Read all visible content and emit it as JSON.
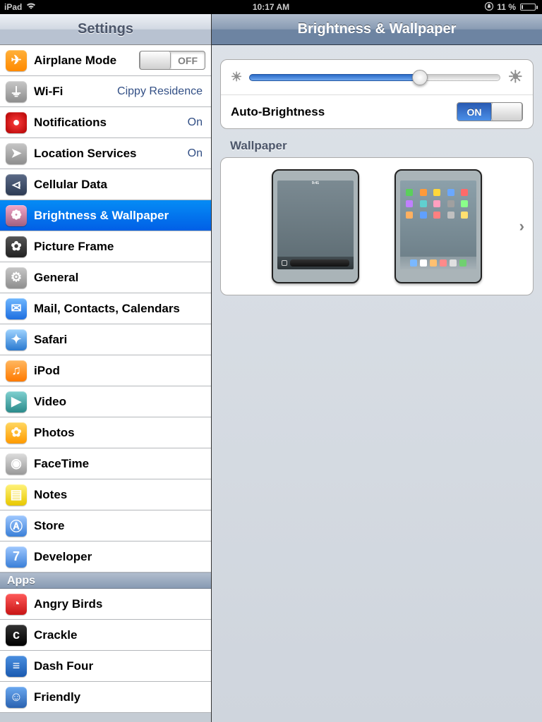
{
  "status": {
    "device": "iPad",
    "time": "10:17 AM",
    "battery_pct": "11 %",
    "battery_fill": 11
  },
  "sidebar": {
    "title": "Settings",
    "items": [
      {
        "label": "Airplane Mode",
        "icon_bg": "linear-gradient(#ffb03a,#ff8a00)",
        "glyph": "✈",
        "toggle": "OFF"
      },
      {
        "label": "Wi-Fi",
        "icon_bg": "linear-gradient(#c7c7c7,#8e8e8e)",
        "glyph": "⏚",
        "value": "Cippy Residence"
      },
      {
        "label": "Notifications",
        "icon_bg": "radial-gradient(#ff4040,#b00000)",
        "glyph": "●",
        "value": "On"
      },
      {
        "label": "Location Services",
        "icon_bg": "linear-gradient(#c7c7c7,#8e8e8e)",
        "glyph": "➤",
        "value": "On"
      },
      {
        "label": "Cellular Data",
        "icon_bg": "linear-gradient(#5b6a86,#2d3b54)",
        "glyph": "⏿"
      },
      {
        "label": "Brightness & Wallpaper",
        "icon_bg": "linear-gradient(#f4a6c8,#a06080)",
        "glyph": "❁",
        "selected": true
      },
      {
        "label": "Picture Frame",
        "icon_bg": "linear-gradient(#555,#222)",
        "glyph": "✿"
      },
      {
        "label": "General",
        "icon_bg": "linear-gradient(#c7c7c7,#8e8e8e)",
        "glyph": "⚙"
      },
      {
        "label": "Mail, Contacts, Calendars",
        "icon_bg": "linear-gradient(#6fb7ff,#1e6fe0)",
        "glyph": "✉"
      },
      {
        "label": "Safari",
        "icon_bg": "linear-gradient(#9fd4ff,#2a79d0)",
        "glyph": "✦"
      },
      {
        "label": "iPod",
        "icon_bg": "linear-gradient(#ffb760,#ff7a00)",
        "glyph": "♫"
      },
      {
        "label": "Video",
        "icon_bg": "linear-gradient(#7fd0d0,#2a8a8a)",
        "glyph": "▶"
      },
      {
        "label": "Photos",
        "icon_bg": "linear-gradient(#ffd760,#ff9a00)",
        "glyph": "✿"
      },
      {
        "label": "FaceTime",
        "icon_bg": "linear-gradient(#ddd,#999)",
        "glyph": "◉"
      },
      {
        "label": "Notes",
        "icon_bg": "linear-gradient(#fff27a,#e8c800)",
        "glyph": "▤"
      },
      {
        "label": "Store",
        "icon_bg": "linear-gradient(#9fc8ff,#3a7fd8)",
        "glyph": "Ⓐ"
      },
      {
        "label": "Developer",
        "icon_bg": "linear-gradient(#9fc8ff,#3a7fd8)",
        "glyph": "7"
      }
    ],
    "apps_header": "Apps",
    "apps": [
      {
        "label": "Angry Birds",
        "icon_bg": "linear-gradient(#ff5a5a,#c81414)",
        "glyph": "◔"
      },
      {
        "label": "Crackle",
        "icon_bg": "linear-gradient(#333,#000)",
        "glyph": "c"
      },
      {
        "label": "Dash Four",
        "icon_bg": "linear-gradient(#4a8fe0,#1a5ab0)",
        "glyph": "≡"
      },
      {
        "label": "Friendly",
        "icon_bg": "linear-gradient(#6aa8f0,#2a62b0)",
        "glyph": "☺"
      }
    ]
  },
  "detail": {
    "title": "Brightness & Wallpaper",
    "brightness_pct": 68,
    "auto_brightness_label": "Auto-Brightness",
    "auto_brightness_value": "ON",
    "wallpaper_label": "Wallpaper",
    "lock_time": "9:41"
  }
}
